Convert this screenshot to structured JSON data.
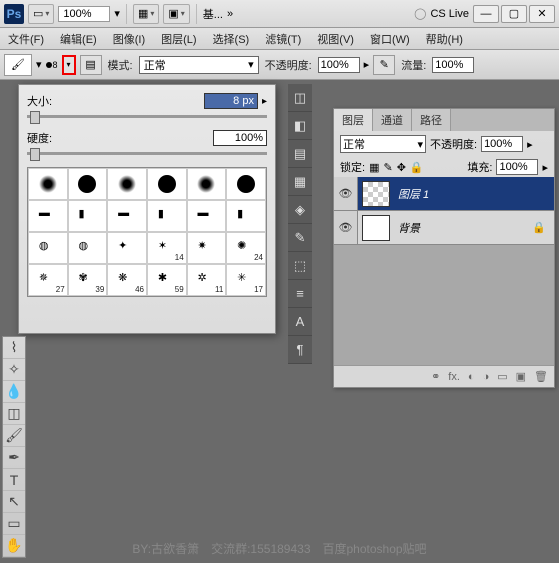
{
  "titlebar": {
    "app": "Ps",
    "zoom": "100%",
    "doc_label": "基...",
    "double_chev": "»",
    "cslive": "CS Live",
    "min": "—",
    "max": "▢",
    "close": "✕"
  },
  "menu": {
    "file": "文件(F)",
    "edit": "编辑(E)",
    "image": "图像(I)",
    "layer": "图层(L)",
    "select": "选择(S)",
    "filter": "滤镜(T)",
    "view": "视图(V)",
    "window": "窗口(W)",
    "help": "帮助(H)"
  },
  "optbar": {
    "brush_size": "8",
    "mode_label": "模式:",
    "mode_value": "正常",
    "opacity_label": "不透明度:",
    "opacity_value": "100%",
    "flow_label": "流量:",
    "flow_value": "100%"
  },
  "brush_panel": {
    "size_label": "大小:",
    "size_value": "8 px",
    "hardness_label": "硬度:",
    "hardness_value": "100%",
    "thumbs": [
      "",
      "",
      "",
      "",
      "",
      "",
      "",
      "",
      "",
      "",
      "",
      "",
      "",
      "",
      "",
      "14",
      "",
      "24",
      "27",
      "39",
      "46",
      "59",
      "11",
      "17"
    ]
  },
  "layers": {
    "tab_layers": "图层",
    "tab_channels": "通道",
    "tab_paths": "路径",
    "blend_mode": "正常",
    "opacity_label": "不透明度:",
    "opacity_value": "100%",
    "lock_label": "锁定:",
    "fill_label": "填充:",
    "fill_value": "100%",
    "layer1": "图层 1",
    "background": "背景"
  },
  "credit": "BY:古欲香箫　交流群:155189433　百度photoshop贴吧"
}
